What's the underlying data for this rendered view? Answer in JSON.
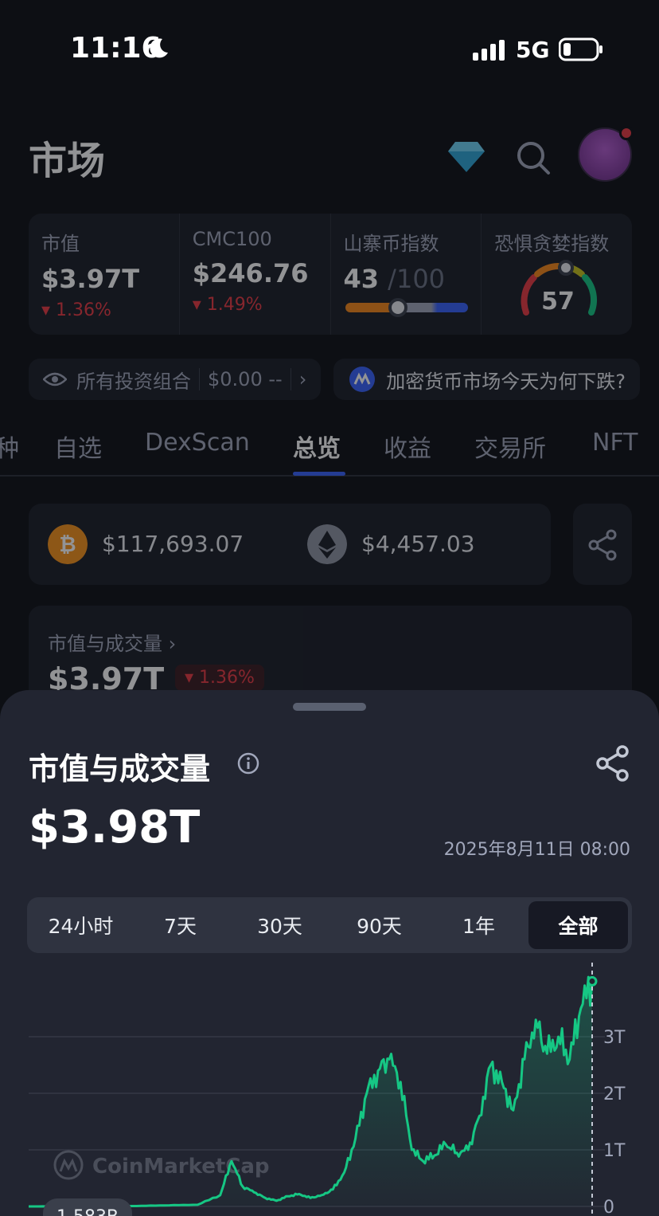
{
  "status_bar": {
    "time": "11:16",
    "network": "5G"
  },
  "header": {
    "title": "市场"
  },
  "stats": [
    {
      "label": "市值",
      "value": "$3.97T",
      "change": "1.36%"
    },
    {
      "label": "CMC100",
      "value": "$246.76",
      "change": "1.49%"
    },
    {
      "label": "山寨币指数",
      "value": "43",
      "suffix": "/100",
      "level": 0.43
    },
    {
      "label": "恐惧贪婪指数",
      "value": "57",
      "level": 0.57
    }
  ],
  "portfolio": {
    "label": "所有投资组合",
    "value": "$0.00",
    "change": "--"
  },
  "news": {
    "text": "加密货币市场今天为何下跌?"
  },
  "tabs": [
    "种",
    "自选",
    "DexScan",
    "总览",
    "收益",
    "交易所",
    "NFT"
  ],
  "active_tab": "总览",
  "prices": {
    "btc": "$117,693.07",
    "eth": "$4,457.03"
  },
  "mc_card": {
    "label": "市值与成交量",
    "value": "$3.97T",
    "change": "1.36%"
  },
  "sheet": {
    "title": "市值与成交量",
    "value": "$3.98T",
    "date": "2025年8月11日 08:00",
    "ranges": [
      "24小时",
      "7天",
      "30天",
      "90天",
      "1年",
      "全部"
    ],
    "active_range": "全部",
    "watermark": "CoinMarketCap",
    "volume_badge": "1.583B"
  },
  "colors": {
    "accent": "#3861fb",
    "positive": "#16c784",
    "negative": "#ea3943"
  },
  "chart_data": {
    "type": "area",
    "yticks": [
      "3T",
      "2T",
      "1T",
      "0"
    ],
    "ylim": [
      0,
      4
    ],
    "series": [
      {
        "x": [
          0,
          0.05,
          0.1,
          0.15,
          0.2,
          0.25,
          0.3,
          0.34,
          0.36,
          0.38,
          0.4,
          0.42,
          0.44,
          0.46,
          0.48,
          0.5,
          0.52,
          0.54,
          0.56,
          0.58,
          0.6,
          0.62,
          0.64,
          0.66,
          0.68,
          0.7,
          0.72,
          0.74,
          0.76,
          0.78,
          0.8,
          0.82,
          0.84,
          0.86,
          0.88,
          0.9,
          0.92,
          0.94,
          0.96,
          0.98,
          1
        ],
        "values": [
          0,
          0,
          0,
          0,
          0.01,
          0.02,
          0.03,
          0.2,
          0.8,
          0.35,
          0.25,
          0.15,
          0.1,
          0.18,
          0.22,
          0.15,
          0.2,
          0.3,
          0.6,
          1.2,
          2.0,
          2.4,
          2.6,
          2.2,
          1.0,
          0.8,
          0.9,
          1.1,
          0.95,
          1.0,
          1.6,
          2.5,
          2.2,
          1.7,
          2.6,
          3.3,
          2.7,
          3.0,
          2.6,
          3.5,
          3.98
        ]
      }
    ]
  }
}
